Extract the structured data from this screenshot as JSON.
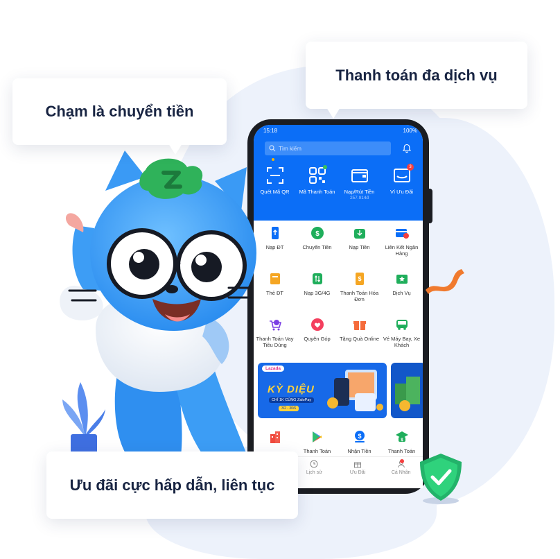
{
  "bubbles": {
    "transfer": "Chạm là chuyển tiền",
    "multi_service": "Thanh toán đa dịch vụ",
    "promo": "Ưu đãi cực hấp dẫn, liên tục"
  },
  "status_bar": {
    "time": "15:18",
    "battery": "100%"
  },
  "search": {
    "placeholder": "Tìm kiếm"
  },
  "quick_actions": [
    {
      "label": "Quét Mã QR",
      "icon": "scan-icon"
    },
    {
      "label": "Mã Thanh Toán",
      "icon": "qr-icon"
    },
    {
      "label": "Nạp/Rút Tiền",
      "sub": "257.914đ",
      "icon": "wallet-icon"
    },
    {
      "label": "Ví Ưu Đãi",
      "icon": "voucher-icon",
      "badge": "3"
    }
  ],
  "services": [
    {
      "label": "Nạp ĐT",
      "icon": "phone-topup-icon"
    },
    {
      "label": "Chuyển Tiền",
      "icon": "transfer-icon"
    },
    {
      "label": "Nạp Tiền",
      "icon": "deposit-icon"
    },
    {
      "label": "Liên Kết Ngân Hàng",
      "icon": "bank-link-icon"
    },
    {
      "label": "Thẻ ĐT",
      "icon": "phone-card-icon"
    },
    {
      "label": "Nạp 3G/4G",
      "icon": "data-icon"
    },
    {
      "label": "Thanh Toán Hóa Đơn",
      "icon": "bill-icon"
    },
    {
      "label": "Dịch Vụ",
      "icon": "star-icon"
    },
    {
      "label": "Thanh Toán Vay Tiêu Dùng",
      "icon": "loan-icon"
    },
    {
      "label": "Quyên Góp",
      "icon": "donate-icon"
    },
    {
      "label": "Tặng Quà Online",
      "icon": "gift-icon"
    },
    {
      "label": "Vé Máy Bay, Xe Khách",
      "icon": "bus-icon"
    }
  ],
  "banner": {
    "brand": "Lazada",
    "title": "KỲ DIỆU",
    "subtitle": "CHỈ 1K CÙNG ZaloPay",
    "date": "3/2 - 30/6"
  },
  "bottom_services": [
    {
      "label": "",
      "icon": "building-icon"
    },
    {
      "label": "Thanh Toán",
      "icon": "play-icon"
    },
    {
      "label": "Nhận Tiền",
      "icon": "receive-icon"
    },
    {
      "label": "Thanh Toán",
      "icon": "tuition-icon"
    }
  ],
  "tabs": [
    {
      "label": "Lịch sử",
      "icon": "clock-icon"
    },
    {
      "label": "Ưu Đãi",
      "icon": "gift-icon"
    },
    {
      "label": "Cá Nhân",
      "icon": "user-icon"
    }
  ],
  "colors": {
    "brand_blue": "#0b6ef7",
    "dark": "#182442",
    "bg_blob": "#edf2fb"
  }
}
